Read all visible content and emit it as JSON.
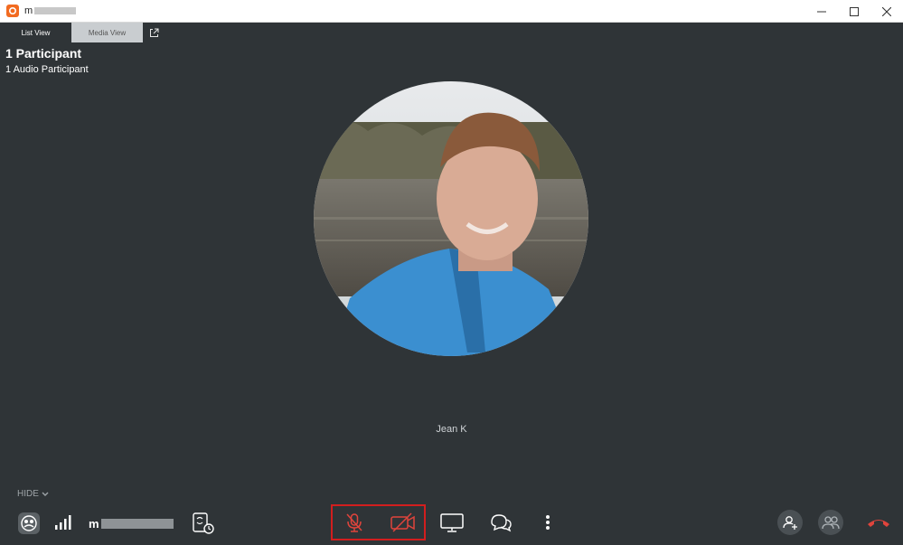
{
  "window": {
    "title_prefix": "m",
    "accent_color": "#f26b21"
  },
  "tabs": [
    {
      "label": "List View",
      "active": true
    },
    {
      "label": "Media View",
      "active": false
    }
  ],
  "summary": {
    "participants": "1 Participant",
    "audio": "1 Audio Participant"
  },
  "participant": {
    "name": "Jean K"
  },
  "controls": {
    "hide_label": "HIDE",
    "username_prefix": "m",
    "highlight_color": "#d21e1e",
    "muted_color": "#e0443c",
    "icons": [
      "self-view-icon",
      "signal-strength-icon",
      "call-settings-icon",
      "mute-microphone-icon",
      "stop-video-icon",
      "share-screen-icon",
      "chat-icon",
      "more-options-icon",
      "add-participant-icon",
      "participants-icon",
      "end-call-icon"
    ]
  }
}
